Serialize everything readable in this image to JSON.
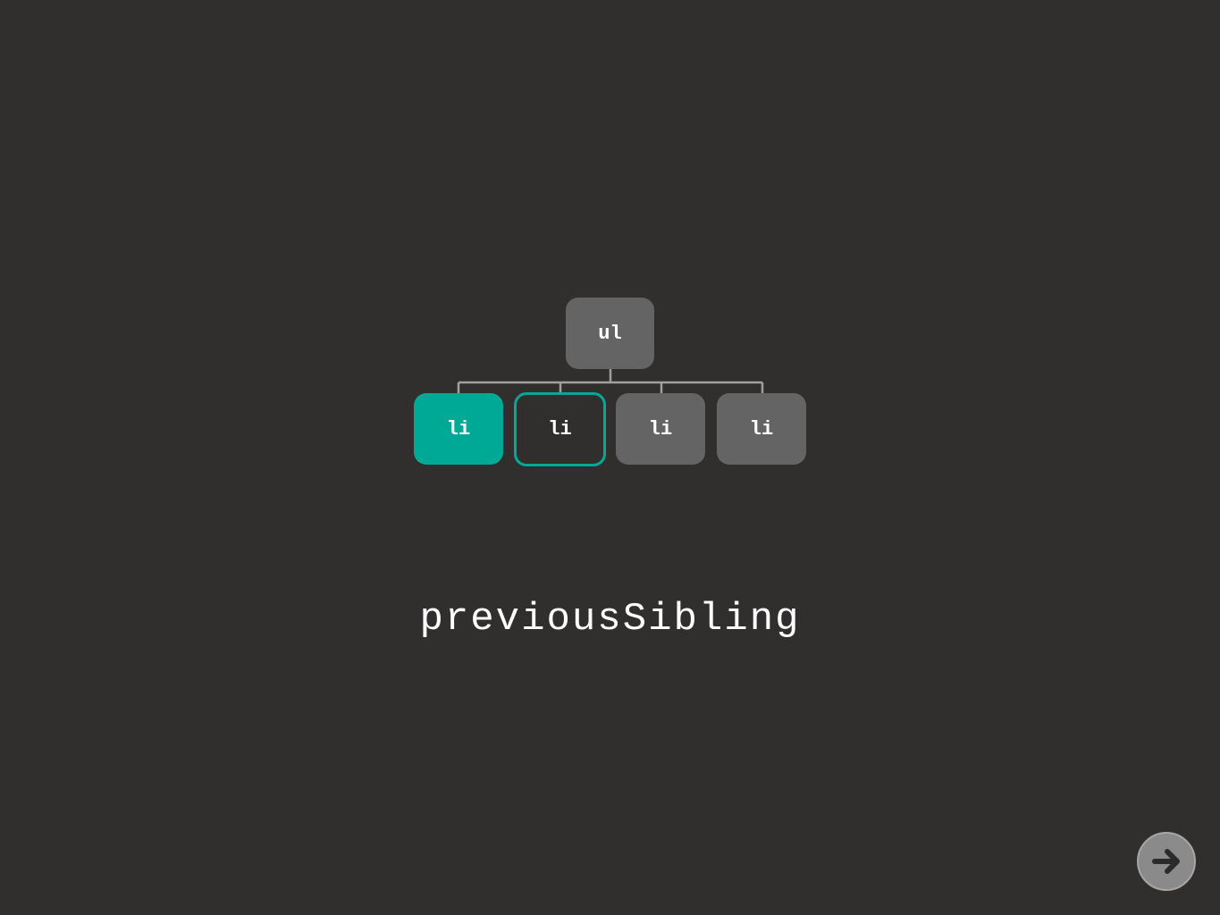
{
  "diagram": {
    "root": {
      "label": "ul"
    },
    "children": [
      {
        "label": "li",
        "state": "current"
      },
      {
        "label": "li",
        "state": "highlighted"
      },
      {
        "label": "li",
        "state": "normal"
      },
      {
        "label": "li",
        "state": "normal"
      }
    ]
  },
  "caption": "previousSibling",
  "navigation": {
    "next_icon": "arrow-right-icon"
  },
  "colors": {
    "background": "#312f2e",
    "node": "#646464",
    "accent": "#00a896",
    "connector": "#a0a0a0"
  }
}
